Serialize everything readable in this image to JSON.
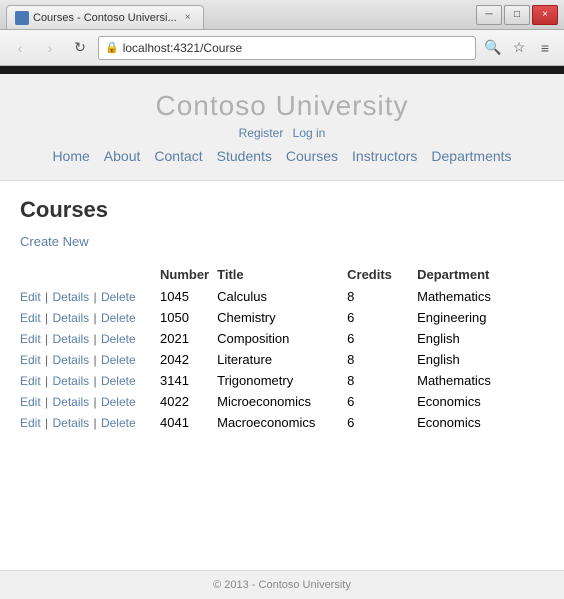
{
  "browser": {
    "title": "Courses - Contoso Universi...",
    "url": "localhost:4321/Course",
    "tab_close": "×",
    "back_btn": "‹",
    "forward_btn": "›",
    "refresh_btn": "↻",
    "min_btn": "─",
    "max_btn": "□",
    "close_btn": "×",
    "search_icon": "🔍",
    "star_icon": "☆",
    "menu_icon": "≡"
  },
  "site": {
    "title": "Contoso University",
    "register_label": "Register",
    "login_label": "Log in",
    "nav": [
      "Home",
      "About",
      "Contact",
      "Students",
      "Courses",
      "Instructors",
      "Departments"
    ]
  },
  "page": {
    "heading": "Courses",
    "create_new": "Create New",
    "table": {
      "headers": [
        "",
        "Number",
        "Title",
        "Credits",
        "Department"
      ],
      "rows": [
        {
          "number": "1045",
          "title": "Calculus",
          "credits": "8",
          "department": "Mathematics"
        },
        {
          "number": "1050",
          "title": "Chemistry",
          "credits": "6",
          "department": "Engineering"
        },
        {
          "number": "2021",
          "title": "Composition",
          "credits": "6",
          "department": "English"
        },
        {
          "number": "2042",
          "title": "Literature",
          "credits": "8",
          "department": "English"
        },
        {
          "number": "3141",
          "title": "Trigonometry",
          "credits": "8",
          "department": "Mathematics"
        },
        {
          "number": "4022",
          "title": "Microeconomics",
          "credits": "6",
          "department": "Economics"
        },
        {
          "number": "4041",
          "title": "Macroeconomics",
          "credits": "6",
          "department": "Economics"
        }
      ],
      "edit_label": "Edit",
      "details_label": "Details",
      "delete_label": "Delete",
      "sep": "|"
    }
  },
  "footer": {
    "text": "© 2013 - Contoso University"
  }
}
